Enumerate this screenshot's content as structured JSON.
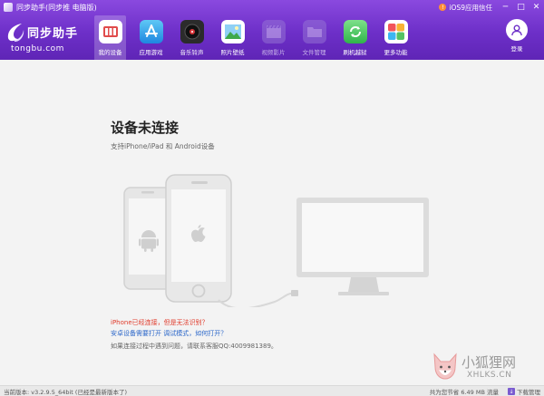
{
  "window": {
    "title": "同步助手(同步推 电脑版)",
    "ios_link": "iOS9应用信任",
    "controls": [
      "─",
      "□",
      "✕"
    ]
  },
  "logo": {
    "name": "同步助手",
    "domain": "tongbu.com"
  },
  "nav": {
    "items": [
      {
        "label": "我的设备",
        "icon": "device-icon",
        "active": true
      },
      {
        "label": "应用游戏",
        "icon": "app-store-icon"
      },
      {
        "label": "音乐铃声",
        "icon": "music-icon"
      },
      {
        "label": "照片壁纸",
        "icon": "photo-icon"
      },
      {
        "label": "视频影片",
        "icon": "video-icon",
        "disabled": true
      },
      {
        "label": "文件管理",
        "icon": "folder-icon",
        "disabled": true
      },
      {
        "label": "刷机越狱",
        "icon": "flash-icon"
      },
      {
        "label": "更多功能",
        "icon": "more-icon"
      }
    ],
    "login_label": "登录"
  },
  "main": {
    "heading": "设备未连接",
    "subheading": "支持iPhone/iPad 和 Android设备",
    "warn_text": "iPhone已经连接，但是无法识别？",
    "help_text": "安卓设备需要打开 调试模式，如何打开？",
    "contact_text": "如果连接过程中遇到问题，请联系客服QQ:4009981389。"
  },
  "statusbar": {
    "version": "当前版本: v3.2.9.5_64bit  (已经是最新版本了)",
    "speed": "共为您节省 6.49 MB 流量",
    "download_label": "下载管理"
  },
  "watermark": {
    "cn": "小狐狸网",
    "en": "XHLKS.CN"
  },
  "colors": {
    "header": "#6d2fc8",
    "warn": "#e03a2a",
    "link": "#2a66c9",
    "device_gray": "#dcdcdc"
  }
}
